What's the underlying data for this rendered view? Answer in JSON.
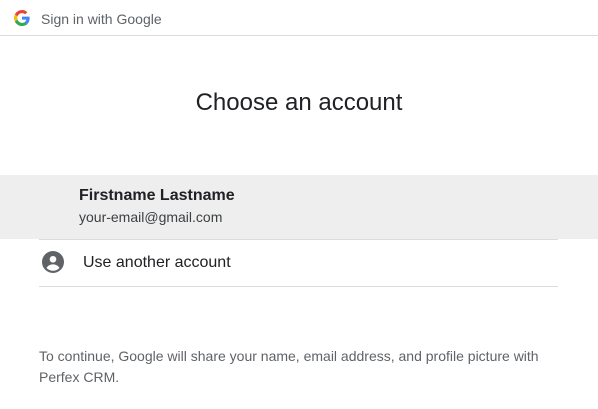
{
  "header": {
    "title": "Sign in with Google",
    "logo_icon": "google-g-icon"
  },
  "main": {
    "heading": "Choose an account",
    "accounts": [
      {
        "name": "Firstname Lastname",
        "email": "your-email@gmail.com"
      }
    ],
    "use_another": {
      "label": "Use another account",
      "icon": "person-circle-icon"
    },
    "footer": "To continue, Google will share your name, email address, and profile picture with Perfex CRM."
  },
  "colors": {
    "selected_row_bg": "#eeeeee",
    "divider": "#dadce0",
    "icon_gray": "#5f6368"
  }
}
